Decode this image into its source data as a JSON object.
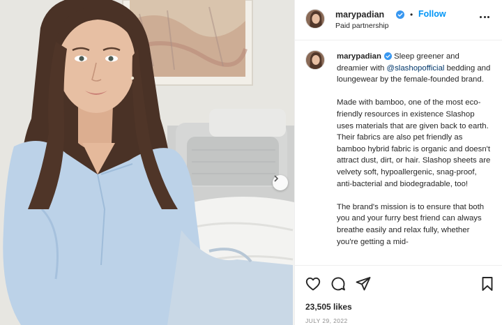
{
  "post": {
    "username": "marypadian",
    "follow_separator": "•",
    "follow_label": "Follow",
    "subtitle": "Paid partnership",
    "caption_intro": "Sleep greener and dreamier with",
    "caption_mention": "@slashopofficial",
    "caption_intro_end": "bedding and loungewear by the female-founded brand.",
    "caption_p2": "Made with bamboo, one of the most eco-friendly resources in existence Slashop uses materials that are given back to earth. Their fabrics are also pet friendly as bamboo hybrid fabric is organic and doesn't attract dust, dirt, or hair. Slashop sheets are velvety soft, hypoallergenic, snag-proof, anti-bacterial and biodegradable, too!",
    "caption_p3": "The brand's mission is to ensure that both you and your furry best friend can always breathe easily and relax fully, whether you're getting a mid-",
    "likes": "23,505 likes",
    "date": "JULY 29, 2022"
  },
  "icons": {
    "verified": "verified-badge-icon",
    "more": "more-options-icon",
    "like": "heart-icon",
    "comment": "comment-icon",
    "share": "paper-plane-icon",
    "save": "bookmark-icon",
    "carousel_next": "chevron-right-icon"
  },
  "colors": {
    "follow": "#0095f6",
    "verified": "#3897f0",
    "mention": "#00376b",
    "text": "#262626",
    "muted": "#8e8e8e"
  }
}
